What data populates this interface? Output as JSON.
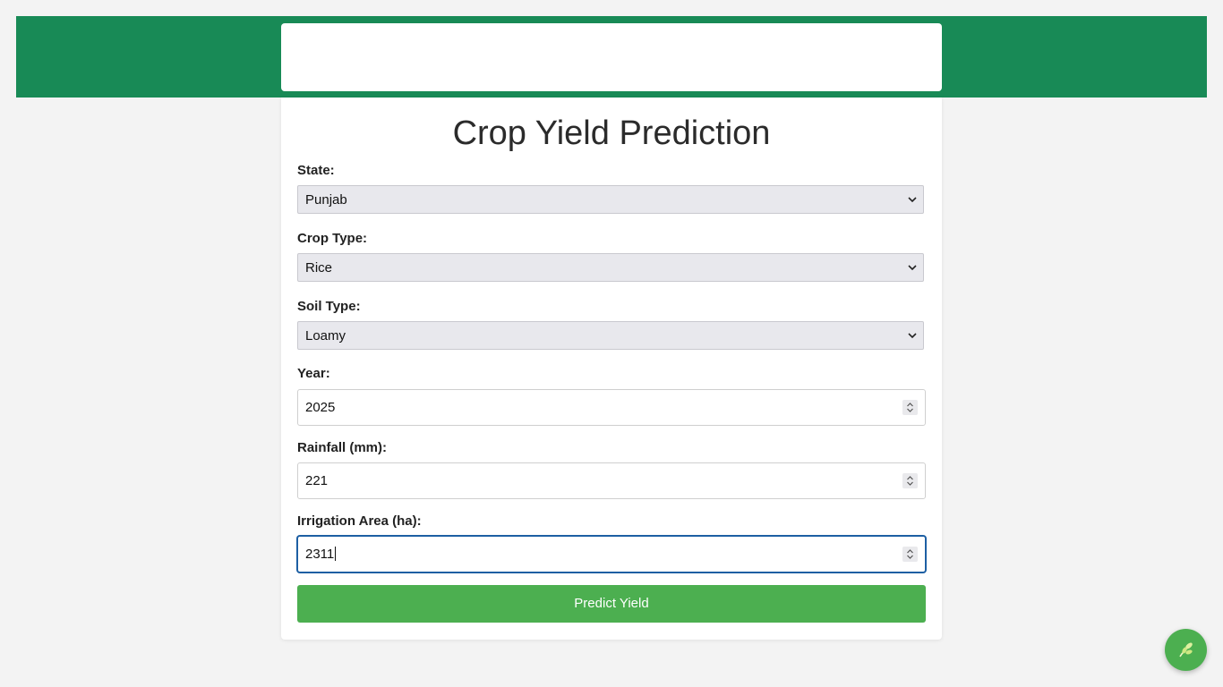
{
  "page": {
    "title": "Crop Yield Prediction"
  },
  "form": {
    "state": {
      "label": "State:",
      "value": "Punjab"
    },
    "crop_type": {
      "label": "Crop Type:",
      "value": "Rice"
    },
    "soil_type": {
      "label": "Soil Type:",
      "value": "Loamy"
    },
    "year": {
      "label": "Year:",
      "value": "2025"
    },
    "rainfall": {
      "label": "Rainfall (mm):",
      "value": "221"
    },
    "irrigation_area": {
      "label": "Irrigation Area (ha):",
      "value": "2311"
    },
    "submit_label": "Predict Yield"
  },
  "colors": {
    "header_green": "#188a56",
    "button_green": "#4caf50",
    "focus_blue": "#1d5fa3"
  },
  "icons": {
    "select_arrow": "chevron-down-icon",
    "number_spinner": "spinner-icon",
    "fab": "leaf-icon"
  }
}
